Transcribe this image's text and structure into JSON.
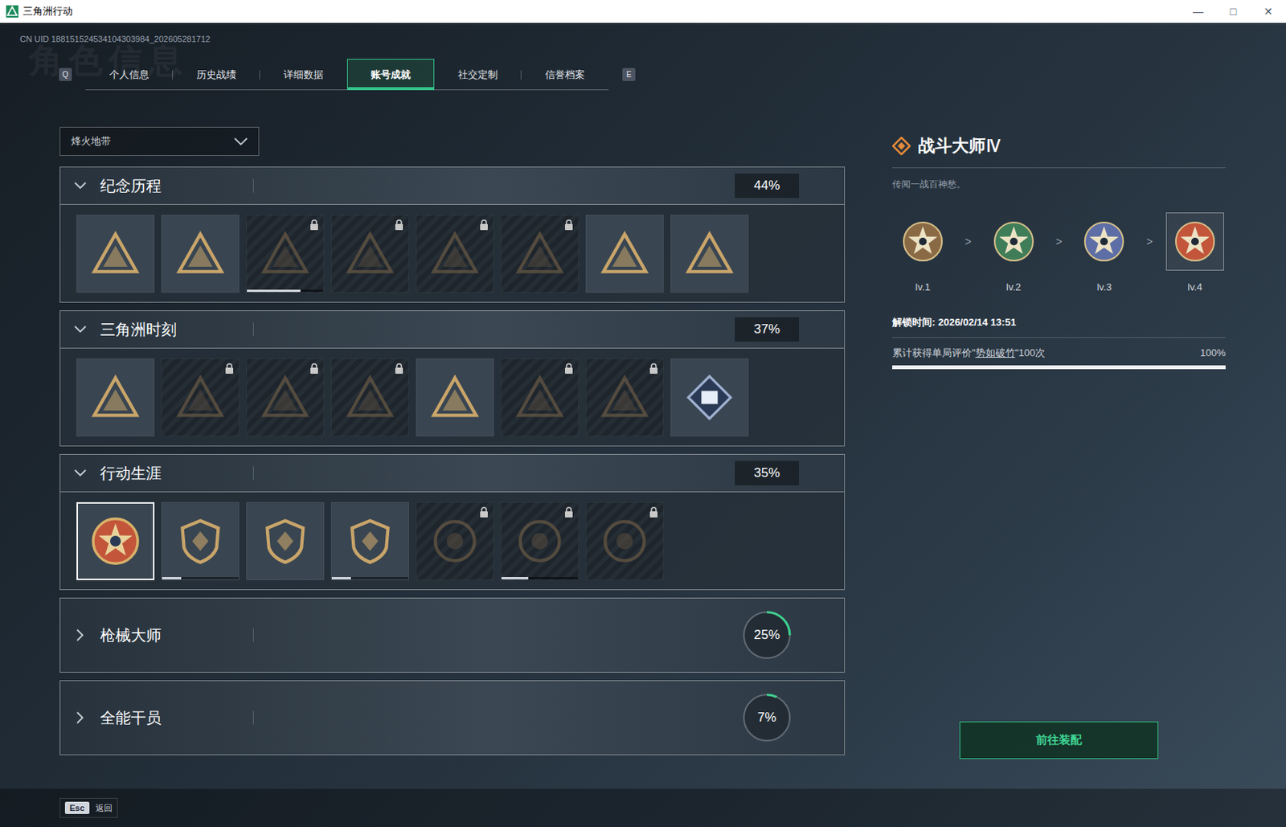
{
  "window": {
    "title": "三角洲行动",
    "controls": [
      "—",
      "□",
      "✕"
    ]
  },
  "uid": "CN UID 188151524534104303984_202605281712",
  "watermark": "角色信息",
  "tab_keys": [
    "Q",
    "E"
  ],
  "tabs": [
    {
      "label": "个人信息",
      "selected": false
    },
    {
      "label": "历史战绩",
      "selected": false
    },
    {
      "label": "详细数据",
      "selected": false
    },
    {
      "label": "账号成就",
      "selected": true
    },
    {
      "label": "社交定制",
      "selected": false
    },
    {
      "label": "信誉档案",
      "selected": false
    }
  ],
  "mode_select": {
    "value": "烽火地带"
  },
  "sections": [
    {
      "title": "纪念历程",
      "percent": "44%",
      "expanded": true,
      "badges": [
        {
          "locked": false,
          "selected": false
        },
        {
          "locked": false,
          "selected": false
        },
        {
          "locked": true,
          "selected": false,
          "level": 0.7
        },
        {
          "locked": true,
          "selected": false
        },
        {
          "locked": true,
          "selected": false
        },
        {
          "locked": true,
          "selected": false
        },
        {
          "locked": false,
          "selected": false
        },
        {
          "locked": false,
          "selected": false
        }
      ]
    },
    {
      "title": "三角洲时刻",
      "percent": "37%",
      "expanded": true,
      "badges": [
        {
          "locked": false,
          "selected": false
        },
        {
          "locked": true,
          "selected": false
        },
        {
          "locked": true,
          "selected": false
        },
        {
          "locked": true,
          "selected": false
        },
        {
          "locked": false,
          "selected": false
        },
        {
          "locked": true,
          "selected": false
        },
        {
          "locked": true,
          "selected": false
        },
        {
          "locked": false,
          "selected": false
        }
      ]
    },
    {
      "title": "行动生涯",
      "percent": "35%",
      "expanded": true,
      "badges": [
        {
          "locked": false,
          "selected": true
        },
        {
          "locked": false,
          "selected": false,
          "level": 0.25
        },
        {
          "locked": false,
          "selected": false
        },
        {
          "locked": false,
          "selected": false,
          "level": 0.25
        },
        {
          "locked": true,
          "selected": false
        },
        {
          "locked": true,
          "selected": false,
          "level": 0.35
        },
        {
          "locked": true,
          "selected": false
        }
      ]
    },
    {
      "title": "枪械大师",
      "percent": "25%",
      "expanded": false,
      "level": 0.25,
      "badges": []
    },
    {
      "title": "全能干员",
      "percent": "7%",
      "expanded": false,
      "level": 0.07,
      "badges": []
    }
  ],
  "detail": {
    "title": "战斗大师Ⅳ",
    "description": "传闻一战百神愁。",
    "arrow": ">",
    "levels": [
      {
        "label": "lv.1",
        "selected": false,
        "color": "#8a6a45"
      },
      {
        "label": "lv.2",
        "selected": false,
        "color": "#3f7d58"
      },
      {
        "label": "lv.3",
        "selected": false,
        "color": "#5d6ea6"
      },
      {
        "label": "lv.4",
        "selected": true,
        "color": "#c2553a"
      }
    ],
    "unlock_time": "解锁时间: 2026/02/14 13:51",
    "condition": {
      "prefix": "累计获得单局评价\"",
      "highlight": "势如破竹",
      "suffix": "\"100次"
    },
    "percent": "100%",
    "level": 1,
    "button": "前往装配"
  },
  "footer": {
    "key": "Esc",
    "label": "返回"
  }
}
